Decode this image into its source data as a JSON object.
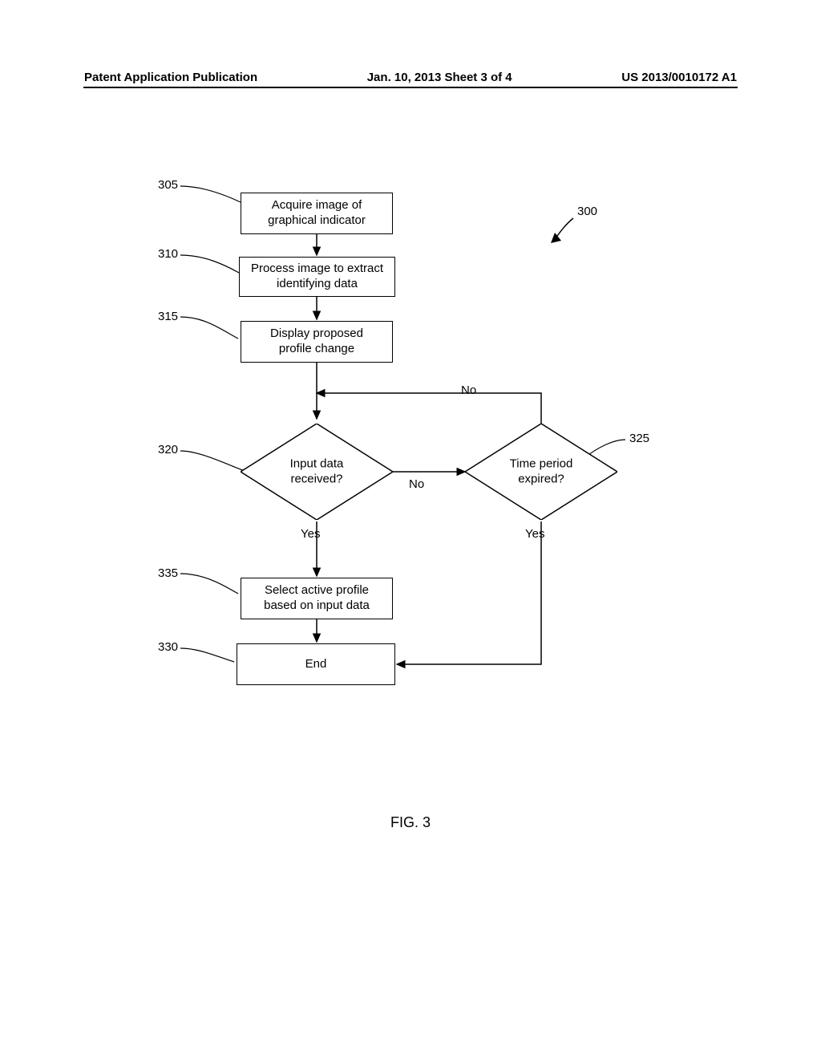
{
  "header": {
    "left": "Patent Application Publication",
    "center": "Jan. 10, 2013  Sheet 3 of 4",
    "right": "US 2013/0010172 A1"
  },
  "refs": {
    "r300": "300",
    "r305": "305",
    "r310": "310",
    "r315": "315",
    "r320": "320",
    "r325": "325",
    "r330": "330",
    "r335": "335"
  },
  "boxes": {
    "b305": "Acquire image of\ngraphical indicator",
    "b310": "Process image to extract\nidentifying data",
    "b315": "Display proposed\nprofile change",
    "b335": "Select active profile\nbased on input data",
    "b330": "End"
  },
  "diamonds": {
    "d320": "Input data\nreceived?",
    "d325": "Time period\nexpired?"
  },
  "edges": {
    "yes1": "Yes",
    "yes2": "Yes",
    "no1": "No",
    "no2": "No"
  },
  "figure_caption": "FIG. 3",
  "chart_data": {
    "type": "flowchart",
    "title": "FIG. 3",
    "figure_ref": "300",
    "nodes": [
      {
        "id": "305",
        "ref": "305",
        "type": "process",
        "label": "Acquire image of graphical indicator"
      },
      {
        "id": "310",
        "ref": "310",
        "type": "process",
        "label": "Process image to extract identifying data"
      },
      {
        "id": "315",
        "ref": "315",
        "type": "process",
        "label": "Display proposed profile change"
      },
      {
        "id": "320",
        "ref": "320",
        "type": "decision",
        "label": "Input data received?"
      },
      {
        "id": "325",
        "ref": "325",
        "type": "decision",
        "label": "Time period expired?"
      },
      {
        "id": "335",
        "ref": "335",
        "type": "process",
        "label": "Select active profile based on input data"
      },
      {
        "id": "330",
        "ref": "330",
        "type": "terminator",
        "label": "End"
      }
    ],
    "edges": [
      {
        "from": "305",
        "to": "310",
        "label": ""
      },
      {
        "from": "310",
        "to": "315",
        "label": ""
      },
      {
        "from": "315",
        "to": "320",
        "label": ""
      },
      {
        "from": "320",
        "to": "325",
        "label": "No"
      },
      {
        "from": "320",
        "to": "335",
        "label": "Yes"
      },
      {
        "from": "325",
        "to": "320",
        "label": "No"
      },
      {
        "from": "325",
        "to": "330",
        "label": "Yes"
      },
      {
        "from": "335",
        "to": "330",
        "label": ""
      }
    ]
  }
}
